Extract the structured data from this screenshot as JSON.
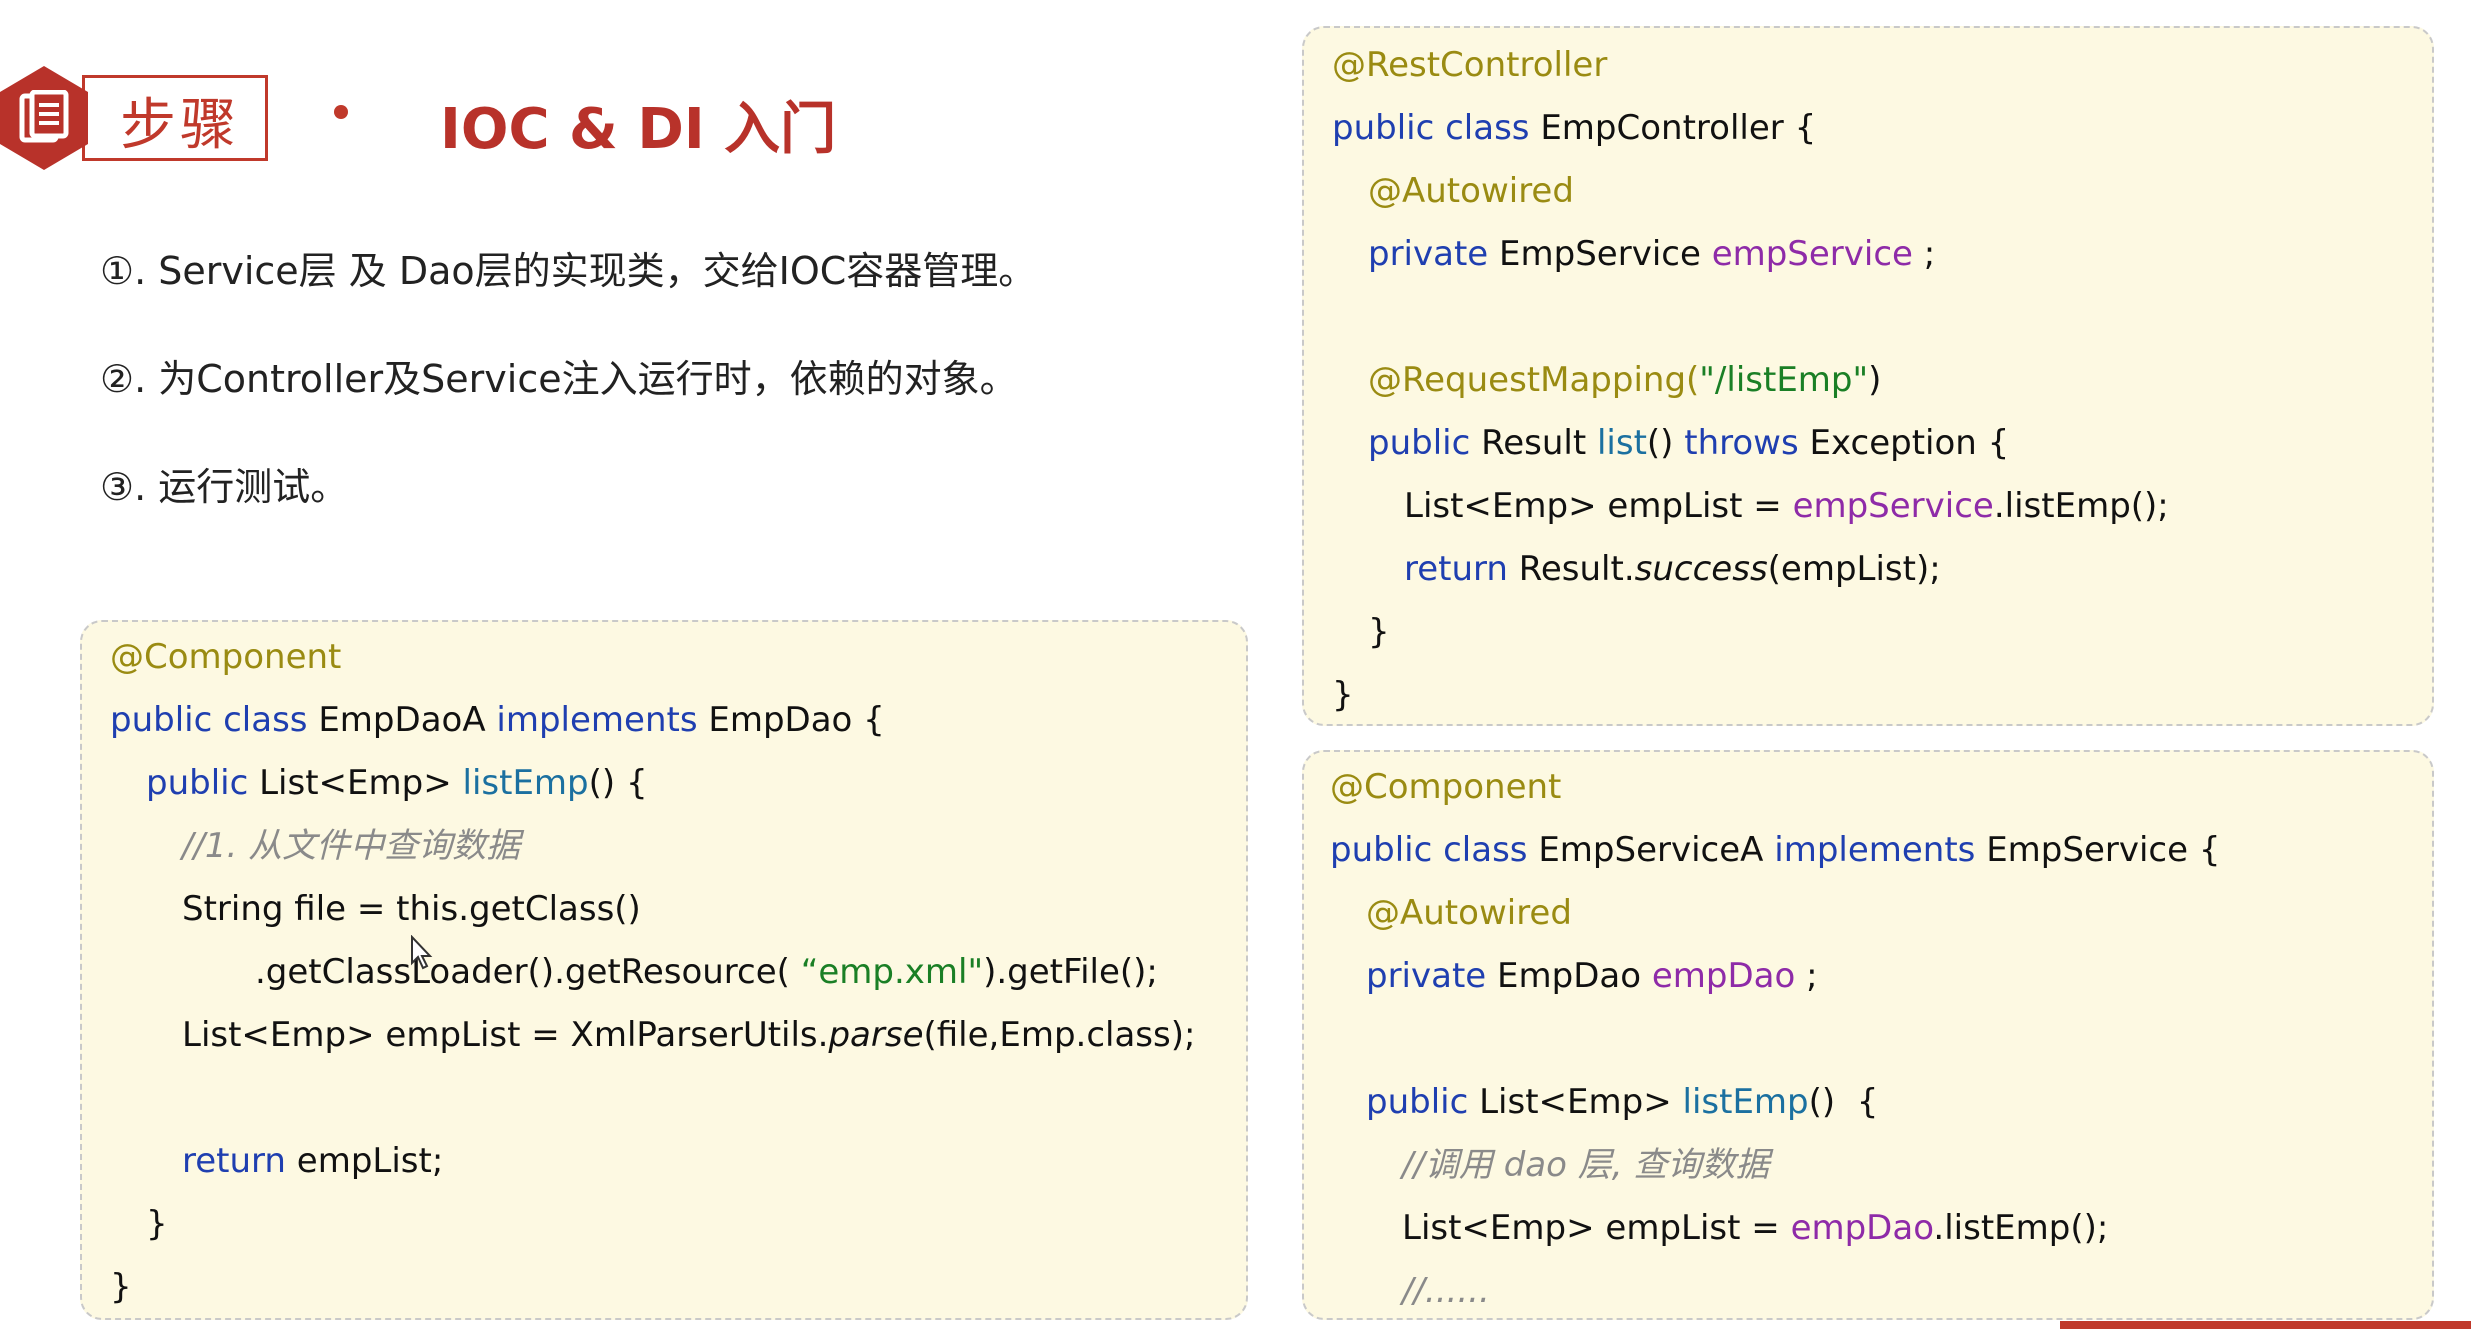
{
  "header": {
    "badge_label": "步骤",
    "title": "IOC & DI 入门"
  },
  "steps": [
    "①. Service层 及 Dao层的实现类，交给IOC容器管理。",
    "②. 为Controller及Service注入运行时，依赖的对象。",
    "③. 运行测试。"
  ],
  "dao_panel": {
    "l1": "@Component",
    "l2_kw": "public class ",
    "l2_name": "EmpDaoA ",
    "l2_kw2": "implements ",
    "l2_iface": "EmpDao {",
    "l3_kw": "public ",
    "l3_type": "List<Emp> ",
    "l3_method": "listEmp",
    "l3_end": "() {",
    "l4_comment": "//1. 从文件中查询数据",
    "l5": "String file = this.getClass()",
    "l6_a": ".getClassLoader().getResource( ",
    "l6_str": "“emp.xml\"",
    "l6_b": ").getFile();",
    "l7_a": "List<Emp> empList = XmlParserUtils.",
    "l7_it": "parse",
    "l7_b": "(file,Emp.class);",
    "l8_kw": "return ",
    "l8_b": "empList;",
    "l9": "}",
    "l10": "}"
  },
  "controller_panel": {
    "l1": "@RestController",
    "l2_kw": "public class ",
    "l2_b": "EmpController {",
    "l3": "@Autowired",
    "l4_kw": "private ",
    "l4_type": "EmpService ",
    "l4_fld": "empService",
    "l4_end": " ;",
    "l5_ann": "@RequestMapping(",
    "l5_str": "\"/listEmp\"",
    "l5_end": ")",
    "l6_kw": "public ",
    "l6_type": "Result ",
    "l6_method": "list",
    "l6_mid": "() ",
    "l6_kw2": "throws ",
    "l6_end": "Exception {",
    "l7_a": "List<Emp> empList = ",
    "l7_fld": "empService",
    "l7_b": ".listEmp();",
    "l8_kw": "return ",
    "l8_a": "Result.",
    "l8_it": "success",
    "l8_b": "(empList);",
    "l9": "}",
    "l10": "}"
  },
  "service_panel": {
    "l1": "@Component",
    "l2_kw": "public class ",
    "l2_name": "EmpServiceA ",
    "l2_kw2": "implements ",
    "l2_iface": "EmpService {",
    "l3": "@Autowired",
    "l4_kw": "private ",
    "l4_type": "EmpDao ",
    "l4_fld": "empDao",
    "l4_end": " ;",
    "l5_kw": "public ",
    "l5_type": "List<Emp> ",
    "l5_method": "listEmp",
    "l5_end": "()  {",
    "l6_comment": "//调用 dao 层, 查询数据",
    "l7_a": "List<Emp> empList = ",
    "l7_fld": "empDao",
    "l7_b": ".listEmp();",
    "l8_comment": "//......"
  },
  "colors": {
    "accent": "#b8322a",
    "panel_bg": "#fdf9e2",
    "annotation": "#9a8b12",
    "keyword": "#1f3fb0",
    "field": "#8e2ba8",
    "string": "#1a7f25",
    "comment": "#8a8a8a"
  }
}
